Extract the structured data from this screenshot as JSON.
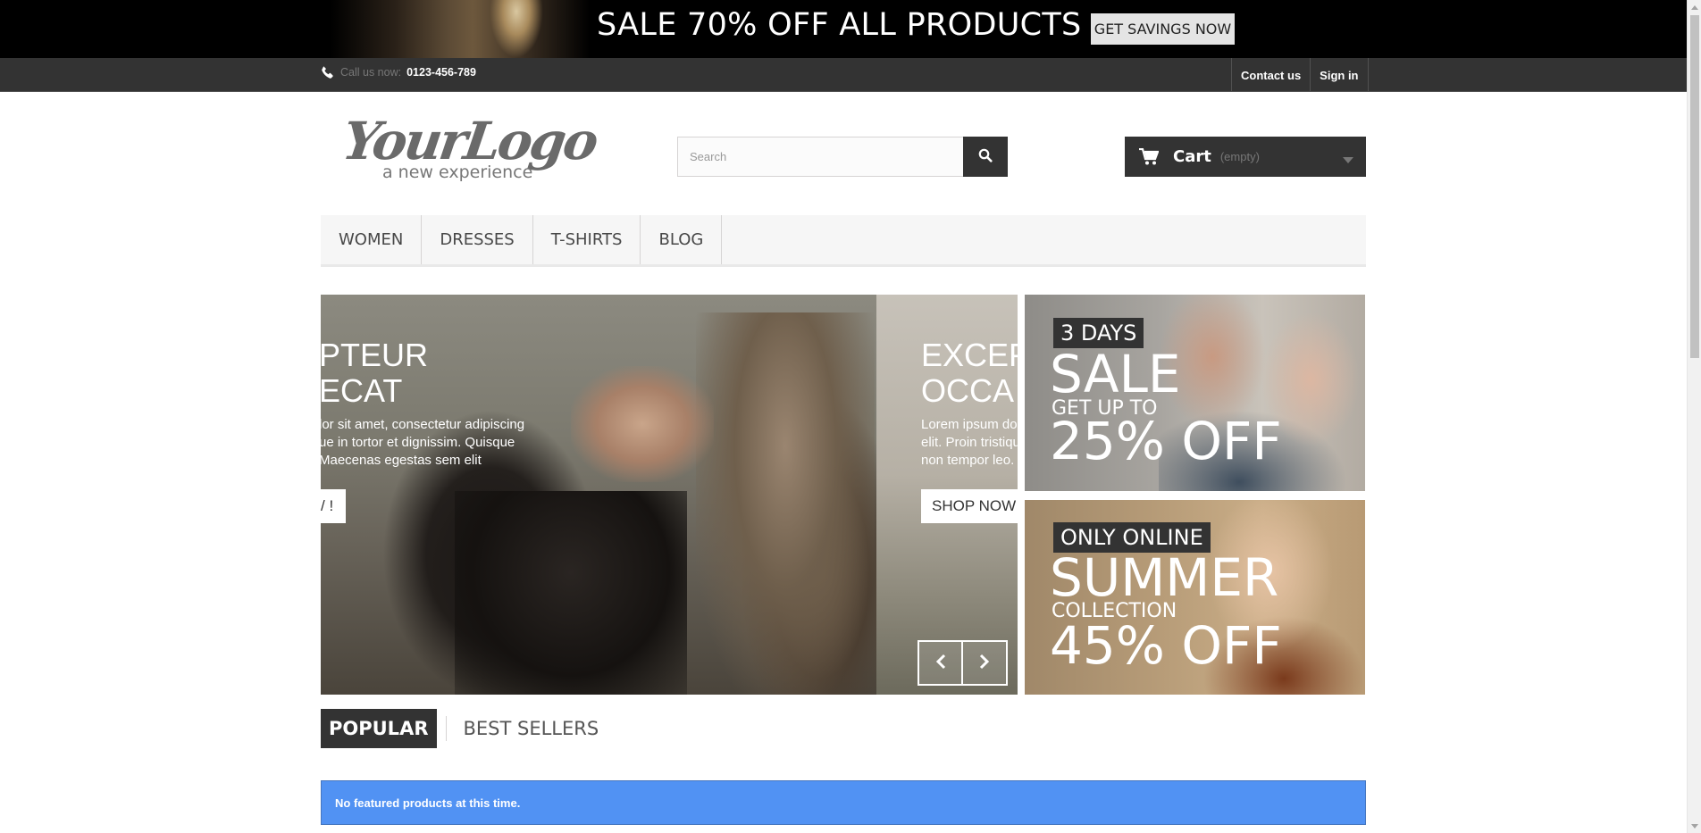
{
  "promo_banner": {
    "text": "SALE 70% OFF ALL PRODUCTS",
    "button_label": "GET SAVINGS NOW"
  },
  "topbar": {
    "call_label": "Call us now:",
    "phone_number": "0123-456-789",
    "links": [
      "Contact us",
      "Sign in"
    ]
  },
  "logo": {
    "main": "YourLogo",
    "tagline": "a new experience"
  },
  "search": {
    "placeholder": "Search"
  },
  "cart": {
    "label": "Cart",
    "status": "(empty)"
  },
  "menu": {
    "items": [
      "WOMEN",
      "DRESSES",
      "T-SHIRTS",
      "BLOG"
    ]
  },
  "slider": {
    "slide1": {
      "title_line1": "PTEUR",
      "title_line2": "ECAT",
      "desc_line1": "lor sit amet, consectetur adipiscing",
      "desc_line2": "ue in tortor et dignissim. Quisque",
      "desc_line3": "Maecenas egestas sem elit",
      "button": "/ !"
    },
    "slide2": {
      "title_line1": "EXCEP",
      "title_line2": "OCCA",
      "desc_line1": "Lorem ipsum do",
      "desc_line2": "elit. Proin tristiqu",
      "desc_line3": "non tempor leo.",
      "button": "SHOP NOW"
    }
  },
  "tiles": {
    "tile1": {
      "badge": "3 DAYS",
      "big": "SALE",
      "mid": "GET UP TO",
      "amount": "25% OFF"
    },
    "tile2": {
      "badge": "ONLY ONLINE",
      "big": "SUMMER",
      "mid": "COLLECTION",
      "amount": "45% OFF"
    }
  },
  "tabs": {
    "items": [
      "POPULAR",
      "BEST SELLERS"
    ],
    "active": "POPULAR"
  },
  "alert": {
    "message": "No featured products at this time."
  },
  "colors": {
    "dark": "#333333",
    "alert_blue": "#5192f3"
  }
}
